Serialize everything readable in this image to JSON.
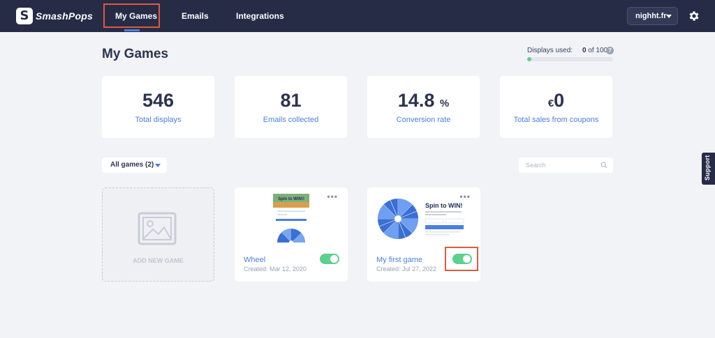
{
  "nav": {
    "logo_letter": "S",
    "brand": "SmashPops",
    "links": [
      "My Games",
      "Emails",
      "Integrations"
    ],
    "site_selector": "nighht.fr",
    "settings_icon": "gear-icon"
  },
  "header": {
    "title": "My Games",
    "usage_label": "Displays used:",
    "usage_value": "0",
    "usage_of": "of 100",
    "usage_fraction": 0.03,
    "help_icon": "question-icon",
    "help_glyph": "?"
  },
  "stats": [
    {
      "value": "546",
      "unit": "",
      "prefix": "",
      "label": "Total displays"
    },
    {
      "value": "81",
      "unit": "",
      "prefix": "",
      "label": "Emails collected"
    },
    {
      "value": "14.8",
      "unit": "%",
      "prefix": "",
      "label": "Conversion rate"
    },
    {
      "value": "0",
      "unit": "",
      "prefix": "€",
      "label": "Total sales from coupons"
    }
  ],
  "filter": {
    "label": "All games (2)"
  },
  "search": {
    "placeholder": "Search",
    "icon": "search-icon"
  },
  "add_card": {
    "label": "ADD NEW GAME",
    "icon": "image-placeholder-icon"
  },
  "games": [
    {
      "name": "Wheel",
      "created": "Created: Mar 12, 2020",
      "enabled": true,
      "thumb_title": "Spin to WIN!!"
    },
    {
      "name": "My first game",
      "created": "Created: Jul 27, 2022",
      "enabled": true,
      "thumb_title": "Spin to WIN!"
    }
  ],
  "support": {
    "label": "Support"
  },
  "colors": {
    "nav_bg": "#262c46",
    "accent": "#4a7fe0",
    "toggle_on": "#5cd08c",
    "highlight": "#e05a3c",
    "page_bg": "#f1f3f6"
  }
}
